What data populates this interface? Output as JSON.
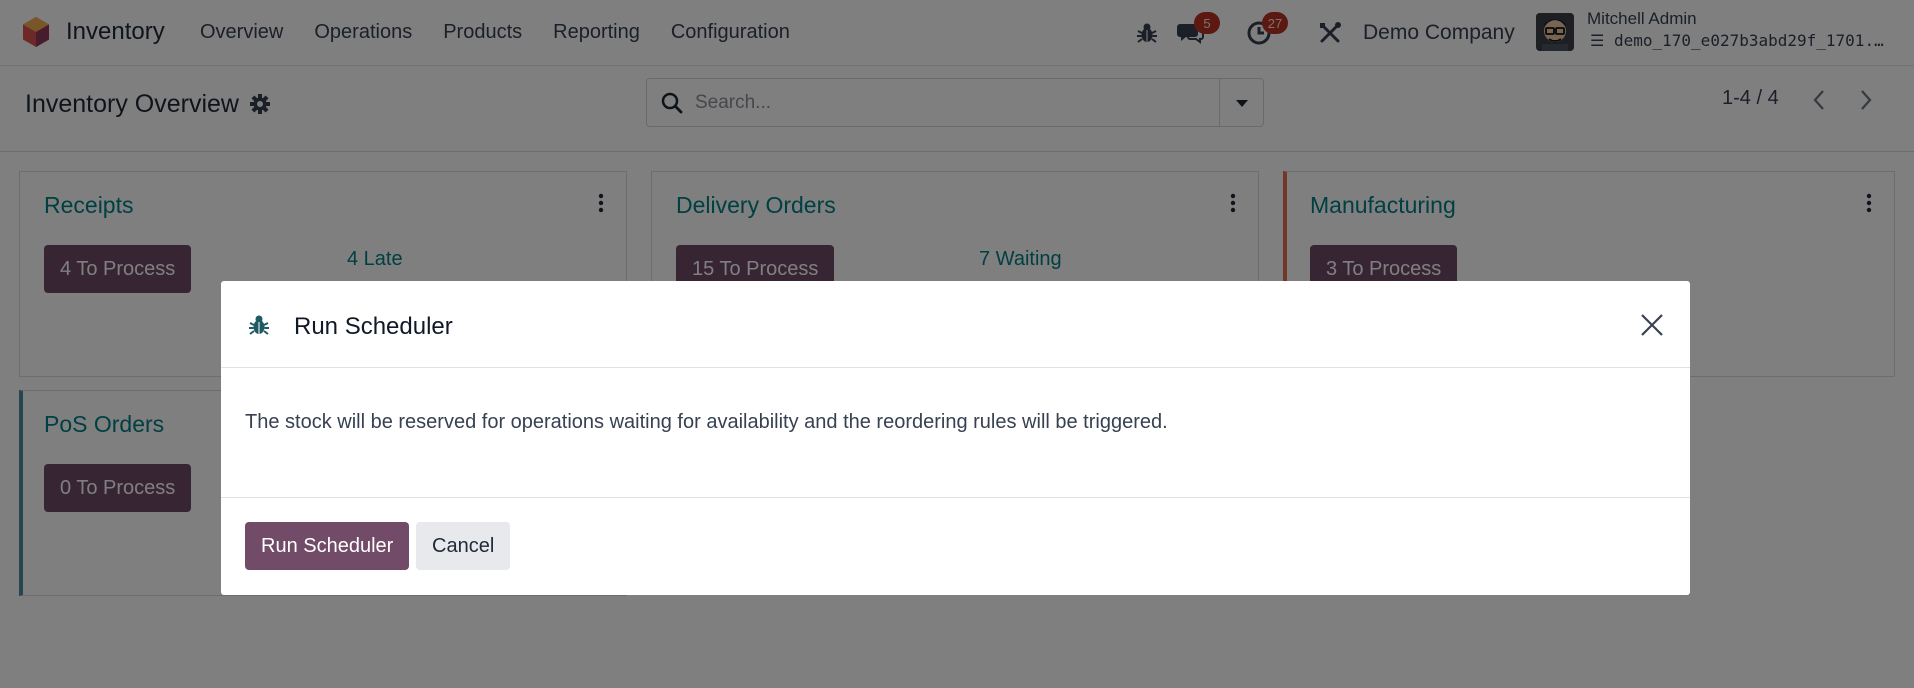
{
  "navbar": {
    "app_name": "Inventory",
    "menu": [
      "Overview",
      "Operations",
      "Products",
      "Reporting",
      "Configuration"
    ],
    "messages_count": "5",
    "activities_count": "27",
    "company": "Demo Company",
    "user_name": "Mitchell Admin",
    "database": "demo_170_e027b3abd29f_1701..."
  },
  "control_panel": {
    "title": "Inventory Overview",
    "search_placeholder": "Search...",
    "pager": "1-4 / 4"
  },
  "cards": [
    {
      "title": "Receipts",
      "button": "4 To Process",
      "stat": "4 Late"
    },
    {
      "title": "Delivery Orders",
      "button": "15 To Process",
      "stat": "7 Waiting"
    },
    {
      "title": "Manufacturing",
      "button": "3 To Process",
      "stat": ""
    },
    {
      "title": "PoS Orders",
      "button": "0 To Process",
      "stat": ""
    }
  ],
  "modal": {
    "title": "Run Scheduler",
    "body": "The stock will be reserved for operations waiting for availability and the reordering rules will be triggered.",
    "primary_label": "Run Scheduler",
    "secondary_label": "Cancel"
  },
  "colors": {
    "brand": "#714b67",
    "accent": "#017e84",
    "manufacturing_border": "#e46e4e",
    "pos_border": "#4a8ba4",
    "badge": "#b83224"
  }
}
